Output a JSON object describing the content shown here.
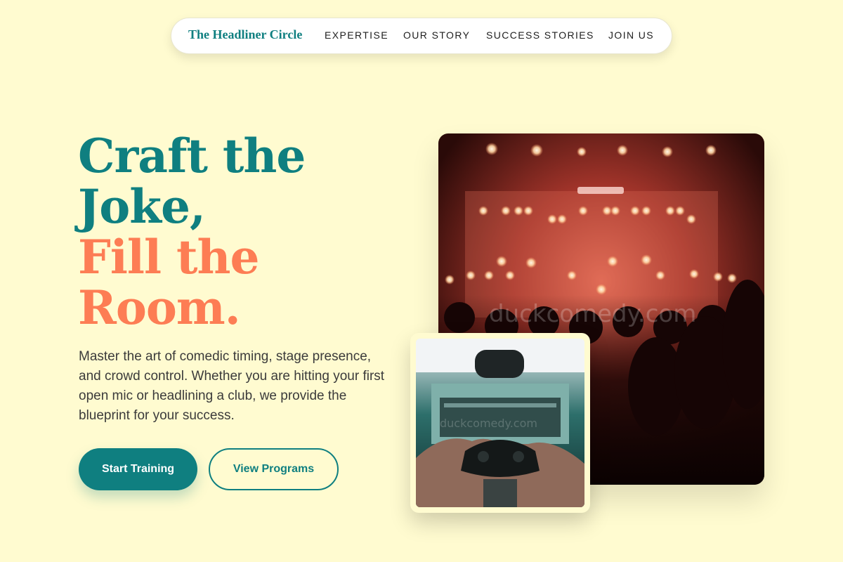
{
  "nav": {
    "brand": "The Headliner Circle",
    "links": [
      "EXPERTISE",
      "OUR STORY",
      "SUCCESS STORIES",
      "JOIN US"
    ]
  },
  "hero": {
    "title_lines": [
      "Craft the",
      "Joke,",
      "Fill the",
      "Room."
    ],
    "description": "Master the art of comedic timing, stage presence, and crowd control. Whether you are hitting your first open mic or headlining a club, we provide the blueprint for your success.",
    "primary_button": "Start Training",
    "secondary_button": "View Programs"
  },
  "images": {
    "concert": {
      "watermark": "duckcomedy.com"
    },
    "gamer": {
      "watermark": "duckcomedy.com"
    }
  },
  "colors": {
    "background": "#fffbd0",
    "teal": "#0f7f80",
    "coral": "#fd7d54",
    "text": "#3b3b3b"
  }
}
